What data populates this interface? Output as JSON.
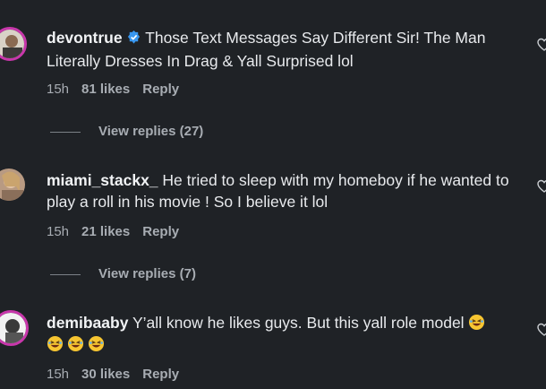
{
  "comments": [
    {
      "username": "devontrue",
      "verified": true,
      "text": "Those Text Messages Say Different Sir! The Man Literally Dresses In Drag & Yall Surprised lol",
      "time": "15h",
      "likes": "81 likes",
      "reply_label": "Reply",
      "view_replies": "View replies (27)"
    },
    {
      "username": "miami_stackx_",
      "verified": false,
      "text": "He tried to sleep with my homeboy if he wanted to play a roll in his movie ! So I believe it lol",
      "time": "15h",
      "likes": "21 likes",
      "reply_label": "Reply",
      "view_replies": "View replies (7)"
    },
    {
      "username": "demibaaby",
      "verified": false,
      "text": "Y’all know he likes guys. But this yall role model",
      "emoji": "laughing-face-emoji",
      "emoji_count": 4,
      "time": "15h",
      "likes": "30 likes",
      "reply_label": "Reply"
    }
  ],
  "colors": {
    "background": "#1f2226",
    "verified_badge": "#3897f0",
    "story_ring": "#c837ab"
  }
}
